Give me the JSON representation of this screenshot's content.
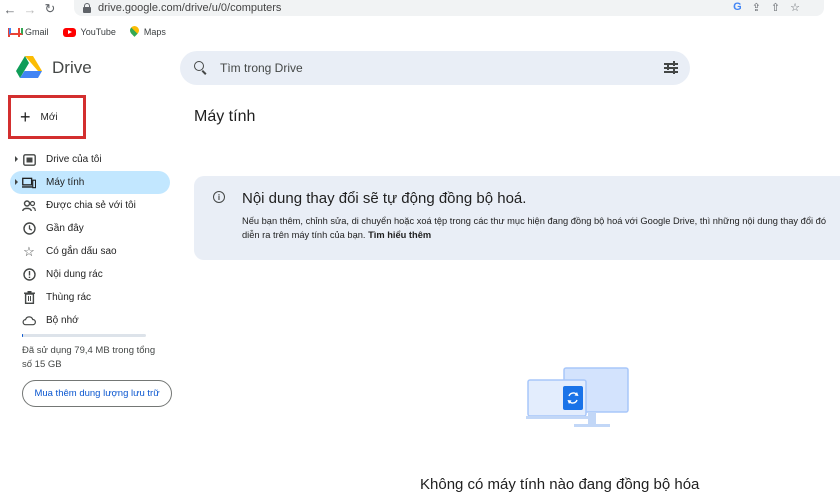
{
  "browser": {
    "url": "drive.google.com/drive/u/0/computers",
    "bookmarks": [
      {
        "label": "Gmail",
        "icon": "gmail-icon"
      },
      {
        "label": "YouTube",
        "icon": "youtube-icon"
      },
      {
        "label": "Maps",
        "icon": "maps-icon"
      }
    ]
  },
  "app": {
    "name": "Drive"
  },
  "search": {
    "placeholder": "Tìm trong Drive"
  },
  "new_button": {
    "label": "Mới"
  },
  "sidebar": {
    "items": [
      {
        "label": "Drive của tôi",
        "icon": "my-drive-icon",
        "expandable": true,
        "active": false
      },
      {
        "label": "Máy tính",
        "icon": "computer-icon",
        "expandable": true,
        "active": true
      },
      {
        "label": "Được chia sẻ với tôi",
        "icon": "shared-icon",
        "expandable": false,
        "active": false
      },
      {
        "label": "Gần đây",
        "icon": "clock-icon",
        "expandable": false,
        "active": false
      },
      {
        "label": "Có gắn dấu sao",
        "icon": "star-icon",
        "expandable": false,
        "active": false
      },
      {
        "label": "Nội dung rác",
        "icon": "spam-icon",
        "expandable": false,
        "active": false
      },
      {
        "label": "Thùng rác",
        "icon": "trash-icon",
        "expandable": false,
        "active": false
      },
      {
        "label": "Bộ nhớ",
        "icon": "cloud-icon",
        "expandable": false,
        "active": false
      }
    ],
    "storage": {
      "text": "Đã sử dụng 79,4 MB trong tổng số 15 GB",
      "used_fraction": 0.005,
      "buy_label": "Mua thêm dung lượng lưu trữ"
    }
  },
  "main": {
    "title": "Máy tính",
    "banner": {
      "title": "Nội dung thay đổi sẽ tự động đồng bộ hoá.",
      "line1": "Nếu bạn thêm, chỉnh sửa, di chuyển hoặc xoá tệp trong các thư mục hiện đang đồng bộ hoá với Google Drive, thì những nội dung thay đổi đó",
      "line2": "diễn ra trên máy tính của bạn.",
      "link": "Tìm hiểu thêm"
    },
    "empty_text": "Không có máy tính nào đang đồng bộ hóa"
  },
  "colors": {
    "accent": "#0b57d0",
    "active_nav": "#c2e7ff",
    "highlight_box": "#d32f2f",
    "surface": "#e9eef6"
  }
}
